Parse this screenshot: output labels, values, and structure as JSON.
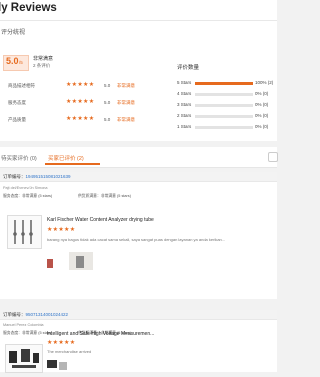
{
  "header": {
    "title": "ly Reviews"
  },
  "summary": {
    "section_label": "评分统视",
    "score": "5.0",
    "score_suffix": "/5",
    "satisfaction_label": "非常满意",
    "review_count": "2 条评价",
    "criteria": [
      {
        "label": "商品描述相符",
        "stars": "★★★★★",
        "score": "5.0",
        "tag": "非常满意"
      },
      {
        "label": "服务态度",
        "stars": "★★★★★",
        "score": "5.0",
        "tag": "非常满意"
      },
      {
        "label": "产品质量",
        "stars": "★★★★★",
        "score": "5.0",
        "tag": "非常满意"
      }
    ],
    "distribution_title": "评价数量",
    "distribution": [
      {
        "label": "5  Stars",
        "percent": 100,
        "percent_text": "100%",
        "count": "(2)"
      },
      {
        "label": "4  Stars",
        "percent": 0,
        "percent_text": "0%",
        "count": "(0)"
      },
      {
        "label": "3  Stars",
        "percent": 0,
        "percent_text": "0%",
        "count": "(0)"
      },
      {
        "label": "2  Stars",
        "percent": 0,
        "percent_text": "0%",
        "count": "(0)"
      },
      {
        "label": "1  Stars",
        "percent": 0,
        "percent_text": "0%",
        "count": "(0)"
      }
    ]
  },
  "tabs": [
    {
      "label": "待买家评价 (0)"
    },
    {
      "label": "买家已评价 (2)"
    }
  ],
  "reviews": [
    {
      "order_prefix": "订单编号：",
      "order_number": "194951515081021639",
      "buyer": "Pajt  del/Evrnev/Jn Simona",
      "service_label": "服务态度：非常满意",
      "service_detail": "(5 stars)",
      "delivery_label": "供货质满意：非常满意",
      "delivery_detail": "(5 stars)",
      "product_title": "Karl Fischer Water Content Analyzer drying tube",
      "stars": "★★★★★",
      "text": "barang nya bagus tidak ada cacat sama sekali, saya sangat puas dengan layanan ya anda kerikan..."
    },
    {
      "order_prefix": "订单编号：",
      "order_number": "95071314001024422",
      "buyer": "Manuel Perez Colombia",
      "service_label": "服务态度：非常满意",
      "service_detail": "(5 stars)",
      "delivery_label": "供货质满意：非常满意",
      "delivery_detail": "(5 stars)",
      "product_title": "Intelligent and Safe High Voltage Measuremen...",
      "stars": "★★★★★",
      "text": "The merchandise arrived"
    }
  ]
}
